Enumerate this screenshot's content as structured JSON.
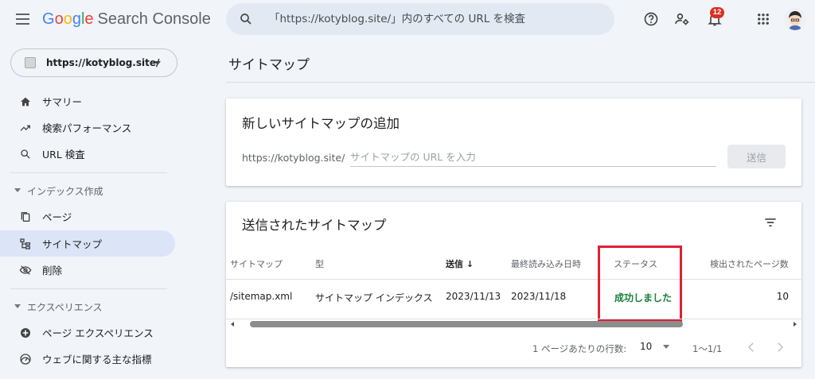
{
  "header": {
    "brand_letters": [
      "G",
      "o",
      "o",
      "g",
      "l",
      "e"
    ],
    "product": "Search Console",
    "search_placeholder": "「https://kotyblog.site/」内のすべての URL を検査",
    "notification_count": "12",
    "icons": [
      "menu-icon",
      "search-icon",
      "help-icon",
      "manage-users-icon",
      "bell-icon",
      "apps-icon"
    ]
  },
  "brand_colors": [
    "#4285f4",
    "#ea4335",
    "#fbbc05",
    "#4285f4",
    "#34a853",
    "#ea4335"
  ],
  "sidebar": {
    "property": "https://kotyblog.site/",
    "items": [
      {
        "label": "サマリー",
        "icon": "home-icon"
      },
      {
        "label": "検索パフォーマンス",
        "icon": "trending-up-icon"
      },
      {
        "label": "URL 検査",
        "icon": "search-icon"
      }
    ],
    "index_section": {
      "label": "インデックス作成",
      "items": [
        {
          "label": "ページ",
          "icon": "pages-icon"
        },
        {
          "label": "サイトマップ",
          "icon": "sitemap-icon"
        },
        {
          "label": "削除",
          "icon": "eye-off-icon"
        }
      ]
    },
    "experience_section": {
      "label": "エクスペリエンス",
      "items": [
        {
          "label": "ページ エクスペリエンス",
          "icon": "plus-circle-icon"
        },
        {
          "label": "ウェブに関する主な指標",
          "icon": "speed-icon"
        }
      ]
    }
  },
  "main": {
    "page_title": "サイトマップ",
    "add_card": {
      "title": "新しいサイトマップの追加",
      "url_prefix": "https://kotyblog.site/",
      "input_placeholder": "サイトマップの URL を入力",
      "submit_label": "送信"
    },
    "list_card": {
      "title": "送信されたサイトマップ",
      "columns": [
        "サイトマップ",
        "型",
        "送信",
        "最終読み込み日時",
        "ステータス",
        "検出されたページ数"
      ],
      "sort_indicator": "↓",
      "rows": [
        [
          "/sitemap.xml",
          "サイトマップ インデックス",
          "2023/11/13",
          "2023/11/18",
          "成功しました",
          "10"
        ]
      ],
      "pager": {
        "rows_per_page_label": "1 ページあたりの行数:",
        "rows_per_page_value": "10",
        "range": "1〜1/1"
      }
    }
  },
  "colors": {
    "accent_active": "#dbe5f7",
    "status_success": "#188038",
    "highlight_box": "#e01f34",
    "badge": "#d93025"
  }
}
